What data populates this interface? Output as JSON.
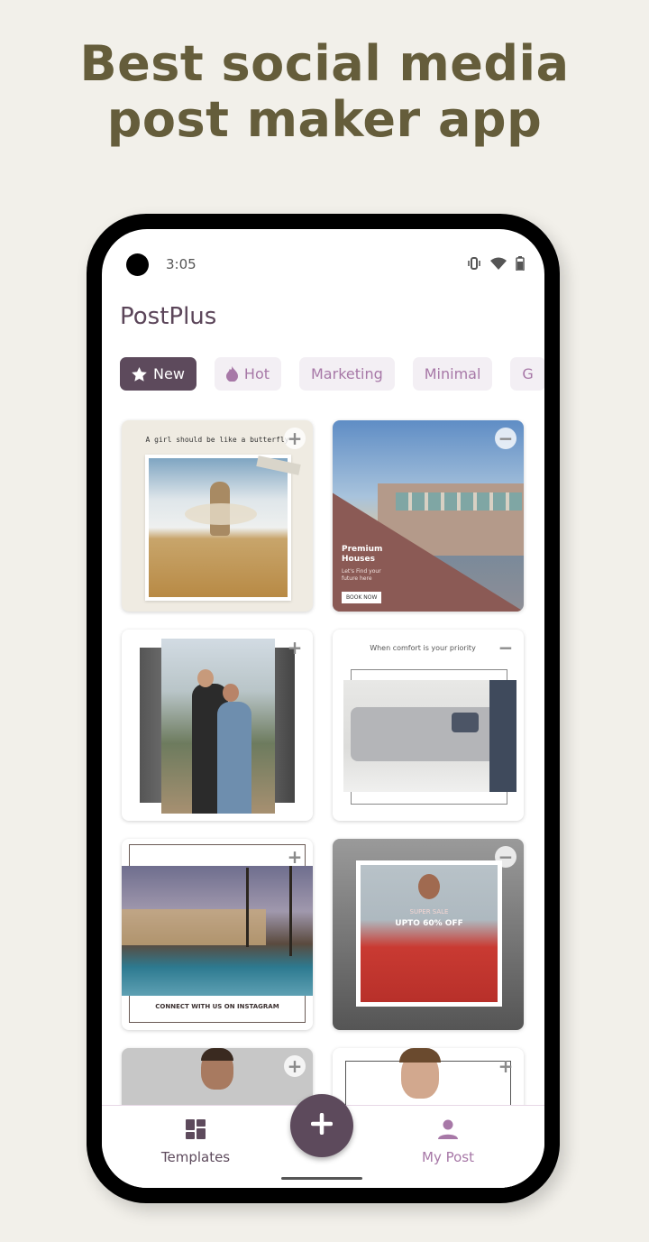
{
  "headline": {
    "line1": "Best social media",
    "line2": "post maker app"
  },
  "status_bar": {
    "time": "3:05",
    "icons": [
      "vibrate-icon",
      "wifi-icon",
      "battery-icon"
    ]
  },
  "app": {
    "title": "PostPlus"
  },
  "categories": [
    {
      "label": "New",
      "icon": "star-icon",
      "active": true
    },
    {
      "label": "Hot",
      "icon": "flame-icon",
      "active": false
    },
    {
      "label": "Marketing",
      "icon": null,
      "active": false
    },
    {
      "label": "Minimal",
      "icon": null,
      "active": false
    },
    {
      "label": "G",
      "icon": null,
      "active": false
    }
  ],
  "templates": [
    {
      "caption": "A girl should be like a butterfly",
      "action": "add",
      "scene": "woman in wheat field"
    },
    {
      "caption": "Premium Houses",
      "subtext": "Let's Find your future here",
      "button": "BOOK NOW",
      "action": "remove",
      "scene": "modern building"
    },
    {
      "caption": "",
      "action": "add",
      "scene": "couple selfie"
    },
    {
      "caption": "When comfort is your priority",
      "action": "remove",
      "scene": "grey sofa"
    },
    {
      "caption": "CONNECT WITH US ON INSTAGRAM",
      "action": "add",
      "scene": "resort pool at dusk"
    },
    {
      "caption": "SUPER SALE",
      "subtext": "UPTO 60% OFF",
      "action": "remove",
      "scene": "woman in red dress"
    },
    {
      "caption": "",
      "action": "add",
      "scene": "bearded man portrait"
    },
    {
      "caption": "",
      "action": "add",
      "scene": "young man portrait"
    }
  ],
  "bottom_nav": {
    "templates_label": "Templates",
    "my_post_label": "My Post",
    "fab_icon": "plus-icon"
  },
  "colors": {
    "background": "#f2f0ea",
    "headline": "#655d3b",
    "brand": "#5d4a5c",
    "chip_text": "#a778a7",
    "chip_bg": "#f3eff4"
  }
}
